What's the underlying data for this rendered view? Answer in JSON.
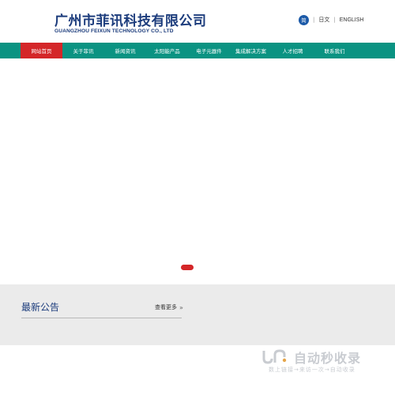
{
  "header": {
    "company_cn": "广州市菲讯科技有限公司",
    "company_en": "GUANGZHOU FEIXUN TECHNOLOGY CO., LTD",
    "lang_simplified": "简",
    "lang_separator": "|",
    "lang_japanese": "日文",
    "lang_english": "ENGLISH"
  },
  "nav": {
    "items": [
      {
        "label": "网站首页"
      },
      {
        "label": "关于菲讯"
      },
      {
        "label": "新闻资讯"
      },
      {
        "label": "太阳能产品"
      },
      {
        "label": "电子元器件"
      },
      {
        "label": "集成解决方案"
      },
      {
        "label": "人才招聘"
      },
      {
        "label": "联系我们"
      }
    ]
  },
  "news": {
    "title": "最新公告",
    "more_label": "查看更多",
    "more_icon": "»"
  },
  "watermark": {
    "title": "自动秒收录",
    "subtitle": "数上链接→来访一次→自动收录"
  },
  "colors": {
    "brand": "#1c3c7c",
    "nav_bg": "#0a9382",
    "nav_active": "#d42628",
    "section_bg": "#ebebeb"
  }
}
